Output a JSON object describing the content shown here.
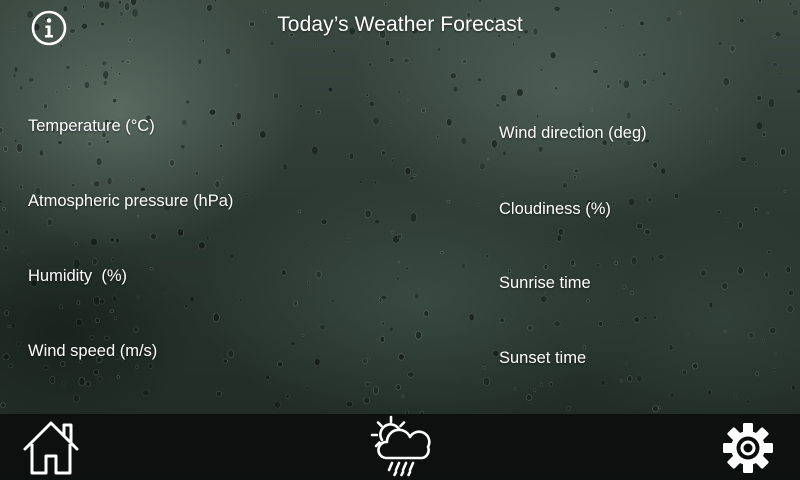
{
  "header": {
    "title": "Today’s Weather Forecast",
    "info_icon": "info-icon"
  },
  "fields": {
    "left": [
      {
        "label": "Temperature (°C)",
        "value": ""
      },
      {
        "label": "Atmospheric pressure (hPa)",
        "value": ""
      },
      {
        "label": "Humidity  (%)",
        "value": ""
      },
      {
        "label": "Wind speed (m/s)",
        "value": ""
      }
    ],
    "right": [
      {
        "label": "Wind direction (deg)",
        "value": ""
      },
      {
        "label": "Cloudiness (%)",
        "value": ""
      },
      {
        "label": "Sunrise time",
        "value": ""
      },
      {
        "label": "Sunset time",
        "value": ""
      }
    ]
  },
  "bottom_bar": {
    "home_icon": "home-icon",
    "weather_icon": "weather-sun-cloud-rain-icon",
    "settings_icon": "gear-icon"
  },
  "colors": {
    "text": "#ffffff",
    "bottom_bar": "#0a0c0b",
    "background": "#2b3731"
  }
}
